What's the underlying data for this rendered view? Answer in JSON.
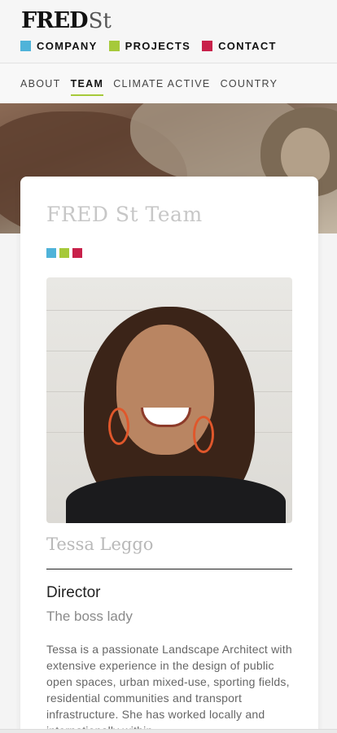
{
  "brand": {
    "logo_bold": "FRED",
    "logo_light": "St"
  },
  "main_nav": [
    {
      "label": "COMPANY",
      "color": "#4fb3d9"
    },
    {
      "label": "PROJECTS",
      "color": "#a6c93a"
    },
    {
      "label": "CONTACT",
      "color": "#c8214a"
    }
  ],
  "sub_nav": [
    {
      "label": "ABOUT",
      "active": false
    },
    {
      "label": "TEAM",
      "active": true
    },
    {
      "label": "CLIMATE ACTIVE",
      "active": false
    },
    {
      "label": "COUNTRY",
      "active": false
    }
  ],
  "page": {
    "title": "FRED St Team",
    "accent_colors": [
      "#4fb3d9",
      "#a6c93a",
      "#c8214a"
    ]
  },
  "member": {
    "name": "Tessa Leggo",
    "role": "Director",
    "tagline": "The boss lady",
    "bio": "Tessa is a passionate Landscape Architect with extensive experience in the design of public open spaces, urban mixed-use, sporting fields, residential communities and transport infrastructure. She has worked locally and internationally within"
  }
}
